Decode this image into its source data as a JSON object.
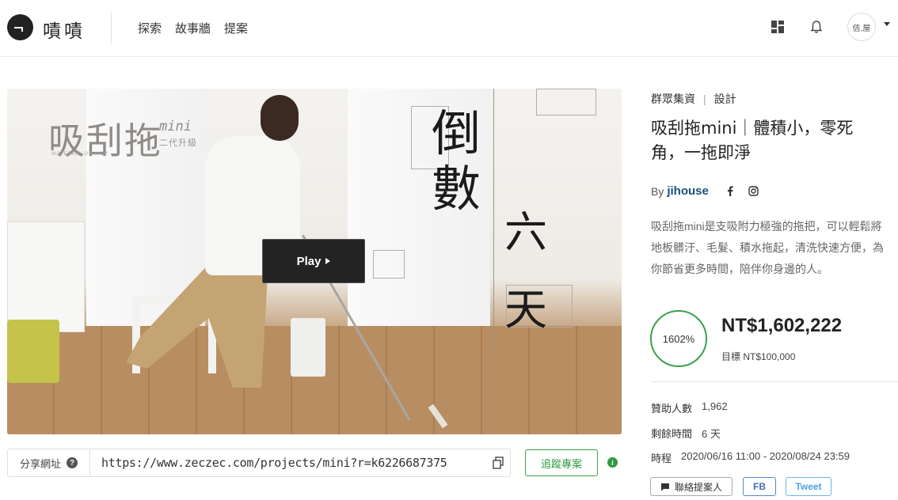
{
  "header": {
    "logo_text": "嘖嘖",
    "nav": [
      "探索",
      "故事牆",
      "提案"
    ],
    "avatar_text": "佶,屋"
  },
  "hero": {
    "brand": "吸刮拖",
    "brand_mini": "mini",
    "brand_sub": "二代升級",
    "brand_tiny": "WATERMELON MOP",
    "countdown": [
      "倒",
      "數",
      "六",
      "天"
    ],
    "play_label": "Play"
  },
  "share": {
    "label": "分享網址",
    "url": "https://www.zeczec.com/projects/mini?r=k6226687375",
    "follow_label": "追蹤專案"
  },
  "project": {
    "category": "群眾集資",
    "category_sep": "|",
    "subcategory": "設計",
    "title": "吸刮拖mini｜體積小，零死角，一拖即淨",
    "by_label": "By",
    "author": "jihouse",
    "description": "吸刮拖mini是支吸附力極強的拖把，可以輕鬆將地板髒汙、毛髮、積水拖起，清洗快速方便，為你節省更多時間，陪伴你身邊的人。",
    "progress_percent": "1602%",
    "raised": "NT$1,602,222",
    "goal": "目標 NT$100,000",
    "stats": [
      {
        "label": "贊助人數",
        "value": "1,962"
      },
      {
        "label": "剩餘時間",
        "value": "6 天"
      },
      {
        "label": "時程",
        "value": "2020/06/16 11:00 - 2020/08/24 23:59"
      }
    ],
    "contact_label": "聯絡提案人",
    "fb_label": "FB",
    "tweet_label": "Tweet"
  },
  "colors": {
    "accent_green": "#3aa14c",
    "author_blue": "#1b4f7a"
  }
}
